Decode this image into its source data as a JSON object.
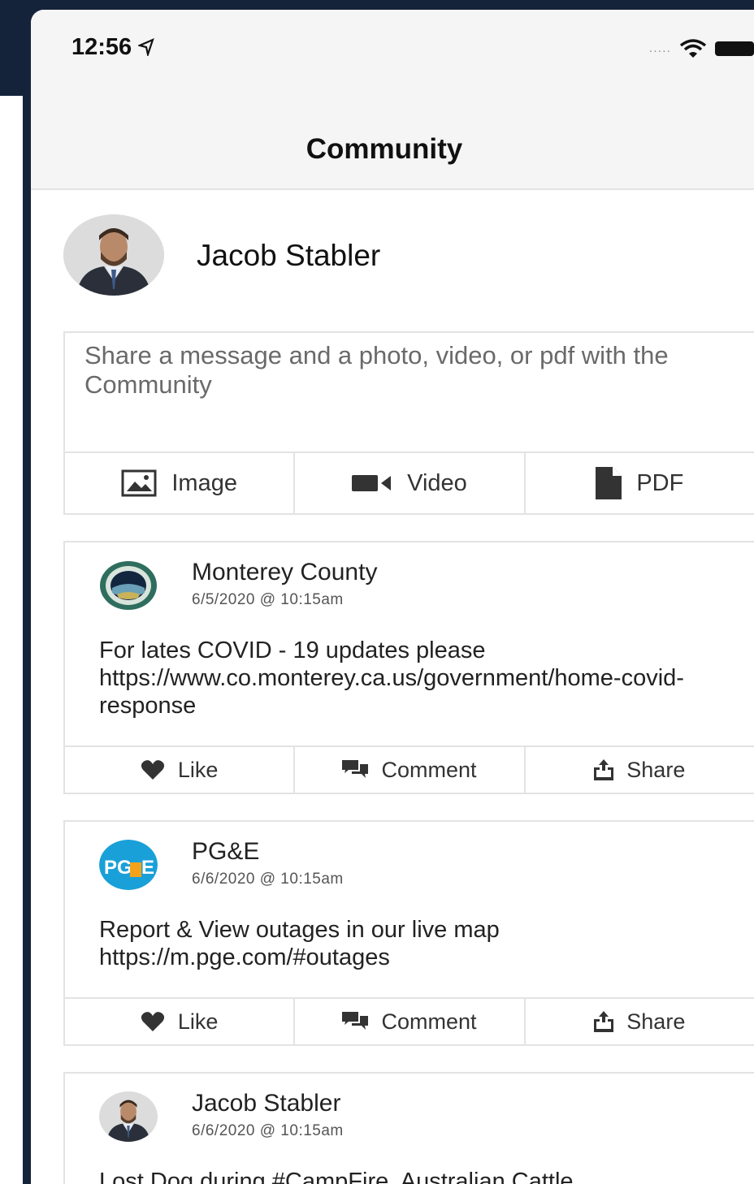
{
  "status": {
    "time": "12:56",
    "signal": "....."
  },
  "nav": {
    "title": "Community"
  },
  "current_user": {
    "name": "Jacob Stabler"
  },
  "composer": {
    "placeholder": "Share a message and a photo, video, or pdf with the Community",
    "image_label": "Image",
    "video_label": "Video",
    "pdf_label": "PDF"
  },
  "posts": [
    {
      "author": "Monterey County",
      "time": "6/5/2020 @ 10:15am",
      "body": "For lates COVID - 19 updates please https://www.co.monterey.ca.us/government/home-covid-response",
      "like": "Like",
      "comment": "Comment",
      "share": "Share"
    },
    {
      "author": "PG&E",
      "time": "6/6/2020 @ 10:15am",
      "body": "Report & View outages in our live map https://m.pge.com/#outages",
      "like": "Like",
      "comment": "Comment",
      "share": "Share"
    },
    {
      "author": "Jacob Stabler",
      "time": "6/6/2020 @ 10:15am",
      "body": "Lost Dog during #CampFire. Australian Cattle"
    }
  ],
  "colors": {
    "background": "#15233a",
    "bar": "#f5f5f5",
    "pge_blue": "#1aa0d8",
    "pge_yellow": "#f5a21b"
  }
}
